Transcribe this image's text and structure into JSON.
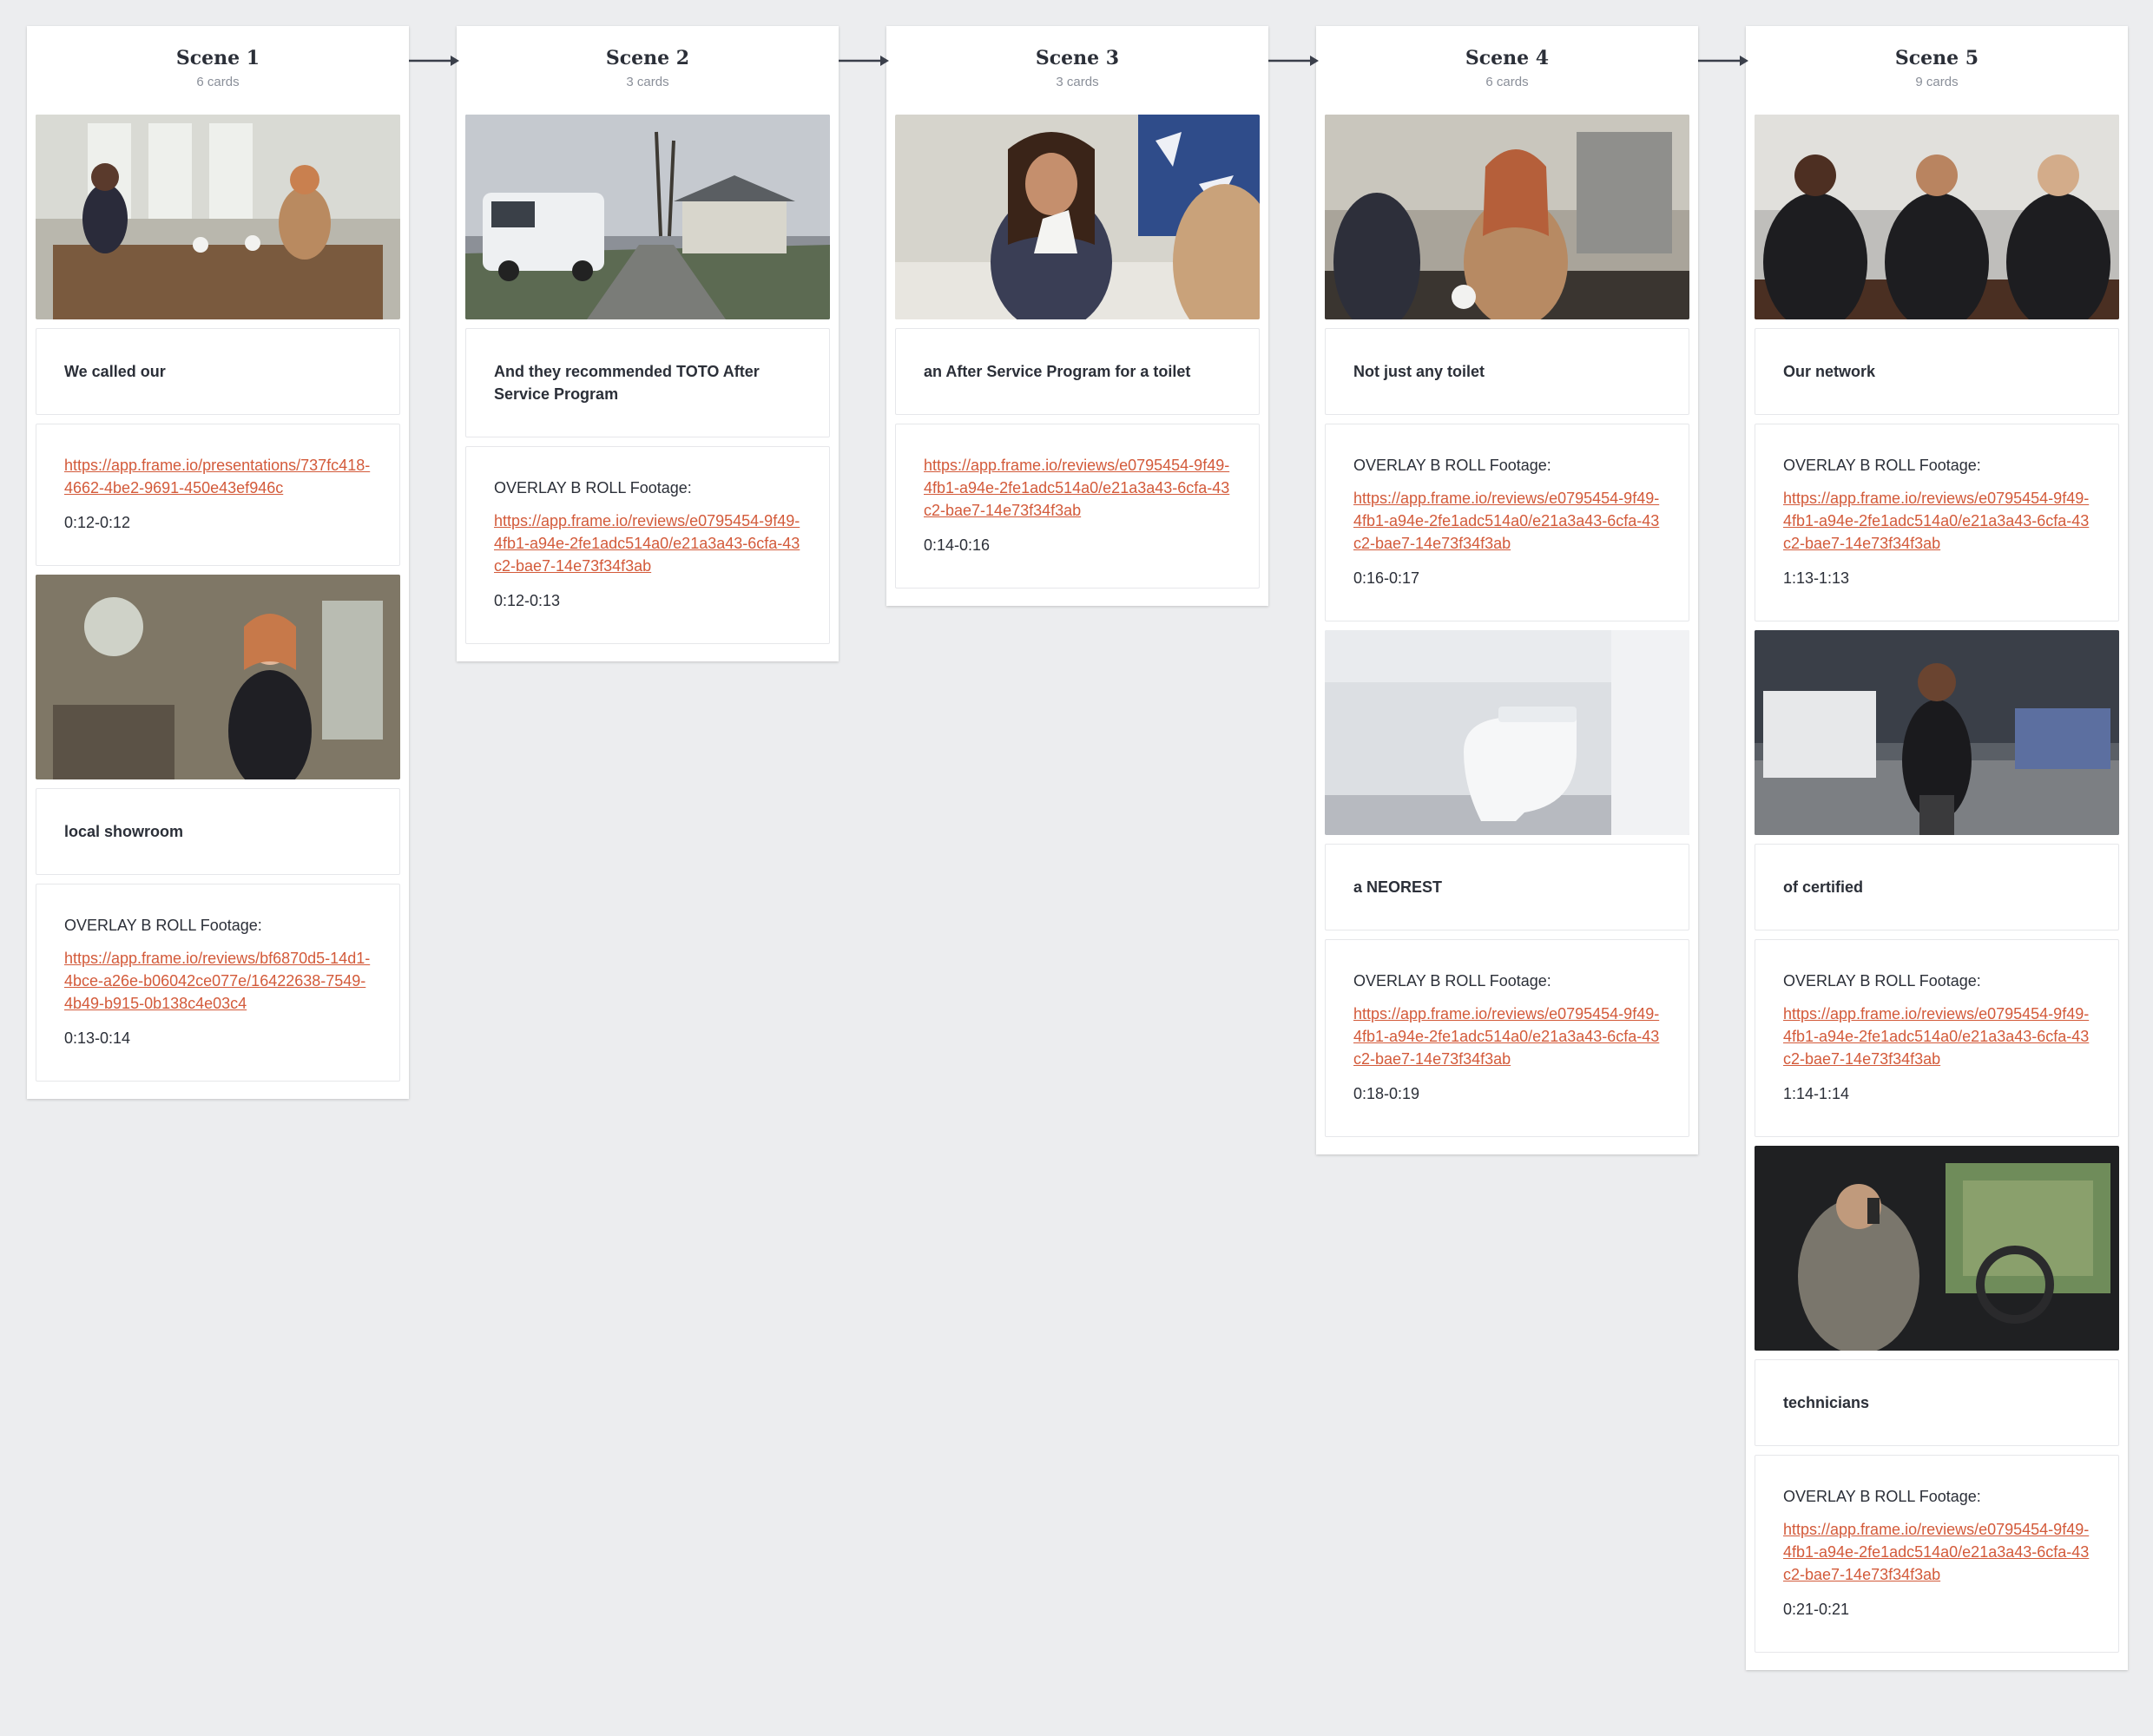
{
  "scenes": [
    {
      "title": "Scene 1",
      "count": "6 cards",
      "cards": [
        {
          "type": "image",
          "description": "two women talking at a wooden kitchen table"
        },
        {
          "type": "caption",
          "text": "We called our"
        },
        {
          "type": "note",
          "label": "",
          "link": "https://app.frame.io/presentations/737fc418-4662-4be2-9691-450e43ef946c",
          "time": "0:12-0:12"
        },
        {
          "type": "image",
          "description": "woman on phone in kitchen"
        },
        {
          "type": "caption",
          "text": "local showroom"
        },
        {
          "type": "note",
          "label": "OVERLAY B ROLL Footage:",
          "link": "https://app.frame.io/reviews/bf6870d5-14d1-4bce-a26e-b06042ce077e/16422638-7549-4b49-b915-0b138c4e03c4",
          "time": "0:13-0:14"
        }
      ]
    },
    {
      "title": "Scene 2",
      "count": "3 cards",
      "cards": [
        {
          "type": "image",
          "description": "white service van parked on residential street"
        },
        {
          "type": "caption",
          "text": "And they recommended TOTO After Service Program"
        },
        {
          "type": "note",
          "label": "OVERLAY B ROLL Footage:",
          "link": "https://app.frame.io/reviews/e0795454-9f49-4fb1-a94e-2fe1adc514a0/e21a3a43-6cfa-43c2-bae7-14e73f34f3ab",
          "time": "0:12-0:13"
        }
      ]
    },
    {
      "title": "Scene 3",
      "count": "3 cards",
      "cards": [
        {
          "type": "image",
          "description": "woman pouring tea at table"
        },
        {
          "type": "caption",
          "text": "an After Service Program for a toilet"
        },
        {
          "type": "note",
          "label": "",
          "link": "https://app.frame.io/reviews/e0795454-9f49-4fb1-a94e-2fe1adc514a0/e21a3a43-6cfa-43c2-bae7-14e73f34f3ab",
          "time": "0:14-0:16"
        }
      ]
    },
    {
      "title": "Scene 4",
      "count": "6 cards",
      "cards": [
        {
          "type": "image",
          "description": "woman speaking in modern kitchen"
        },
        {
          "type": "caption",
          "text": "Not just any toilet"
        },
        {
          "type": "note",
          "label": "OVERLAY B ROLL Footage:",
          "link": "https://app.frame.io/reviews/e0795454-9f49-4fb1-a94e-2fe1adc514a0/e21a3a43-6cfa-43c2-bae7-14e73f34f3ab",
          "time": "0:16-0:17"
        },
        {
          "type": "image",
          "description": "white smart toilet in bathroom"
        },
        {
          "type": "caption",
          "text": "a NEOREST"
        },
        {
          "type": "note",
          "label": "OVERLAY B ROLL Footage:",
          "link": "https://app.frame.io/reviews/e0795454-9f49-4fb1-a94e-2fe1adc514a0/e21a3a43-6cfa-43c2-bae7-14e73f34f3ab",
          "time": "0:18-0:19"
        }
      ]
    },
    {
      "title": "Scene 5",
      "count": "9 cards",
      "cards": [
        {
          "type": "image",
          "description": "three technicians at workshop table"
        },
        {
          "type": "caption",
          "text": "Our network"
        },
        {
          "type": "note",
          "label": "OVERLAY B ROLL Footage:",
          "link": "https://app.frame.io/reviews/e0795454-9f49-4fb1-a94e-2fe1adc514a0/e21a3a43-6cfa-43c2-bae7-14e73f34f3ab",
          "time": "1:13-1:13"
        },
        {
          "type": "image",
          "description": "technician walking in warehouse"
        },
        {
          "type": "caption",
          "text": "of certified"
        },
        {
          "type": "note",
          "label": "OVERLAY B ROLL Footage:",
          "link": "https://app.frame.io/reviews/e0795454-9f49-4fb1-a94e-2fe1adc514a0/e21a3a43-6cfa-43c2-bae7-14e73f34f3ab",
          "time": "1:14-1:14"
        },
        {
          "type": "image",
          "description": "technician on phone inside van"
        },
        {
          "type": "caption",
          "text": "technicians"
        },
        {
          "type": "note",
          "label": "OVERLAY B ROLL Footage:",
          "link": "https://app.frame.io/reviews/e0795454-9f49-4fb1-a94e-2fe1adc514a0/e21a3a43-6cfa-43c2-bae7-14e73f34f3ab",
          "time": "0:21-0:21"
        }
      ]
    }
  ],
  "colors": {
    "background": "#ecedef",
    "link": "#d35a3a",
    "text": "#2b2f38",
    "muted": "#8a8f99",
    "arrow": "#3a3f4a"
  }
}
